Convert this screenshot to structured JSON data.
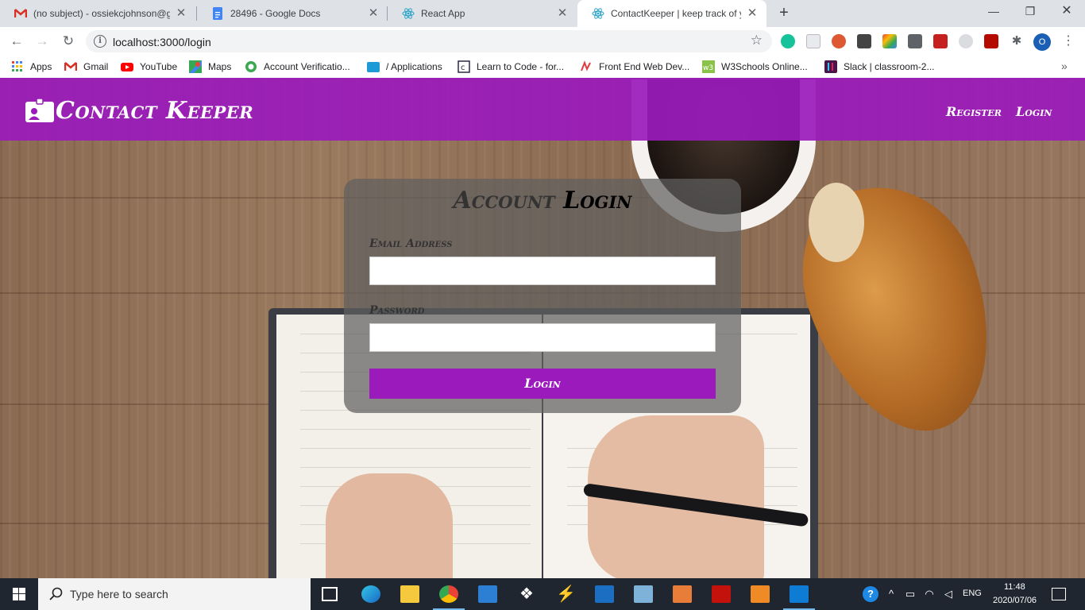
{
  "browser": {
    "tabs": [
      {
        "title": "(no subject) - ossiekcjohnson@gmail.com - Gmail",
        "icon": "gmail-icon"
      },
      {
        "title": "28496 - Google Docs",
        "icon": "google-docs-icon"
      },
      {
        "title": "React App",
        "icon": "react-icon"
      },
      {
        "title": "ContactKeeper | keep track of your contacts",
        "icon": "react-icon",
        "active": true
      }
    ],
    "new_tab": "+",
    "url": "localhost:3000/login",
    "profile_initial": "O"
  },
  "bookmarks": [
    {
      "label": "Apps",
      "icon": "apps-grid-icon"
    },
    {
      "label": "Gmail",
      "icon": "gmail-icon"
    },
    {
      "label": "YouTube",
      "icon": "youtube-icon"
    },
    {
      "label": "Maps",
      "icon": "maps-icon"
    },
    {
      "label": "Account Verificatio...",
      "icon": "verification-icon"
    },
    {
      "label": "/ Applications",
      "icon": "folder-icon"
    },
    {
      "label": "Learn to Code - for...",
      "icon": "freecodecamp-icon"
    },
    {
      "label": "Front End Web Dev...",
      "icon": "frontend-icon"
    },
    {
      "label": "W3Schools Online...",
      "icon": "w3schools-icon"
    },
    {
      "label": "Slack | classroom-2...",
      "icon": "slack-icon"
    }
  ],
  "app": {
    "brand": "Contact Keeper",
    "nav": {
      "register": "Register",
      "login": "Login"
    },
    "form": {
      "title_part1": "Account",
      "title_part2": "Login",
      "email_label": "Email Address",
      "password_label": "Password",
      "submit_label": "Login"
    },
    "colors": {
      "primary": "#9a1abc"
    }
  },
  "taskbar": {
    "search_placeholder": "Type here to search",
    "time": "11:48",
    "date": "2020/07/06",
    "language": "ENG"
  }
}
